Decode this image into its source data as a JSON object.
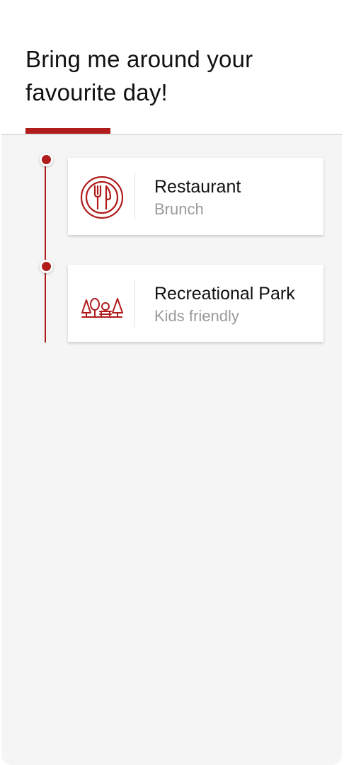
{
  "colors": {
    "accent": "#b01c1c",
    "background": "#f5f5f5",
    "card": "#ffffff",
    "title_text": "#111111",
    "subtitle_text": "#9a9a9a"
  },
  "header": {
    "title": "Bring me around your favourite day!"
  },
  "timeline": {
    "items": [
      {
        "icon": "restaurant-plate-icon",
        "title": "Restaurant",
        "subtitle": "Brunch"
      },
      {
        "icon": "park-trees-icon",
        "title": "Recreational Park",
        "subtitle": "Kids friendly"
      }
    ]
  }
}
